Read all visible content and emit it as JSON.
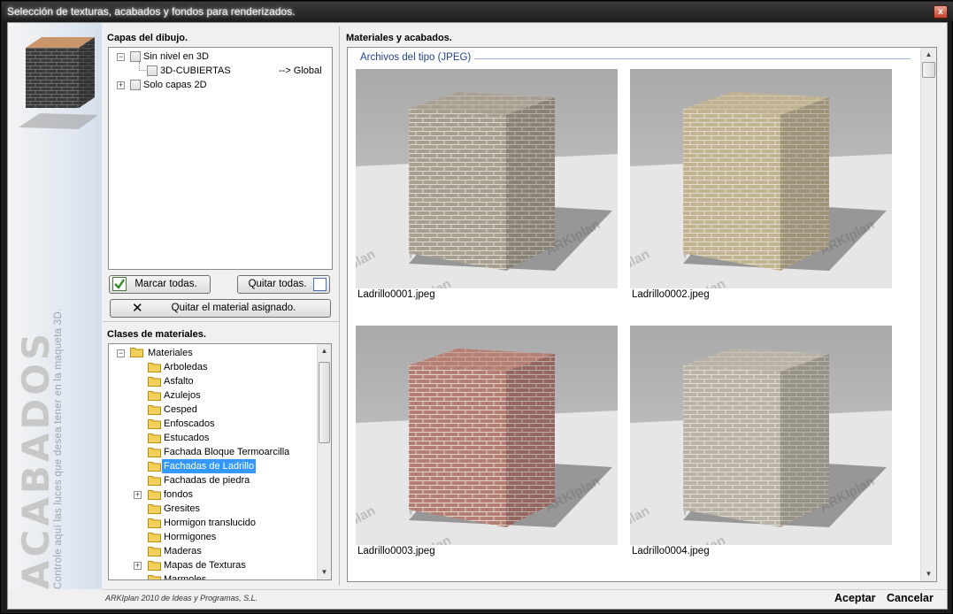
{
  "window": {
    "title": "Selección de texturas, acabados y fondos para renderizados.",
    "close_glyph": "x"
  },
  "brand": {
    "big": "ACABADOS",
    "small": "Controle aquí las luces que desea tener en la maqueta 3D."
  },
  "layers": {
    "label": "Capas del dibujo.",
    "items": [
      {
        "label": "Sin nivel en 3D",
        "expander": "−"
      },
      {
        "label": "3D-CUBIERTAS",
        "value": "--> Global"
      },
      {
        "label": "Solo capas 2D",
        "expander": "+"
      }
    ],
    "mark_all": "Marcar todas.",
    "remove_all": "Quitar todas.",
    "remove_material": "Quitar el material asignado."
  },
  "classes": {
    "label": "Clases de materiales.",
    "root": "Materiales",
    "items": [
      "Arboledas",
      "Asfalto",
      "Azulejos",
      "Cesped",
      "Enfoscados",
      "Estucados",
      "Fachada Bloque Termoarcilla",
      "Fachadas de Ladrillo",
      "Fachadas de piedra",
      "fondos",
      "Gresites",
      "Hormigon translucido",
      "Hormigones",
      "Maderas",
      "Mapas de Texturas",
      "Marmoles"
    ],
    "selected": "Fachadas de Ladrillo"
  },
  "materials": {
    "label": "Materiales y acabados.",
    "group": "Archivos del tipo (JPEG)",
    "files": [
      {
        "name": "Ladrillo0001.jpeg",
        "color": "#a79f90"
      },
      {
        "name": "Ladrillo0002.jpeg",
        "color": "#c2b391"
      },
      {
        "name": "Ladrillo0003.jpeg",
        "color": "#b67d72"
      },
      {
        "name": "Ladrillo0004.jpeg",
        "color": "#b9b2a6"
      }
    ],
    "watermark": "ARKIplan"
  },
  "footer": {
    "note": "ARKIplan 2010 de Ideas y Programas, S.L.",
    "ok": "Aceptar",
    "cancel": "Cancelar"
  }
}
